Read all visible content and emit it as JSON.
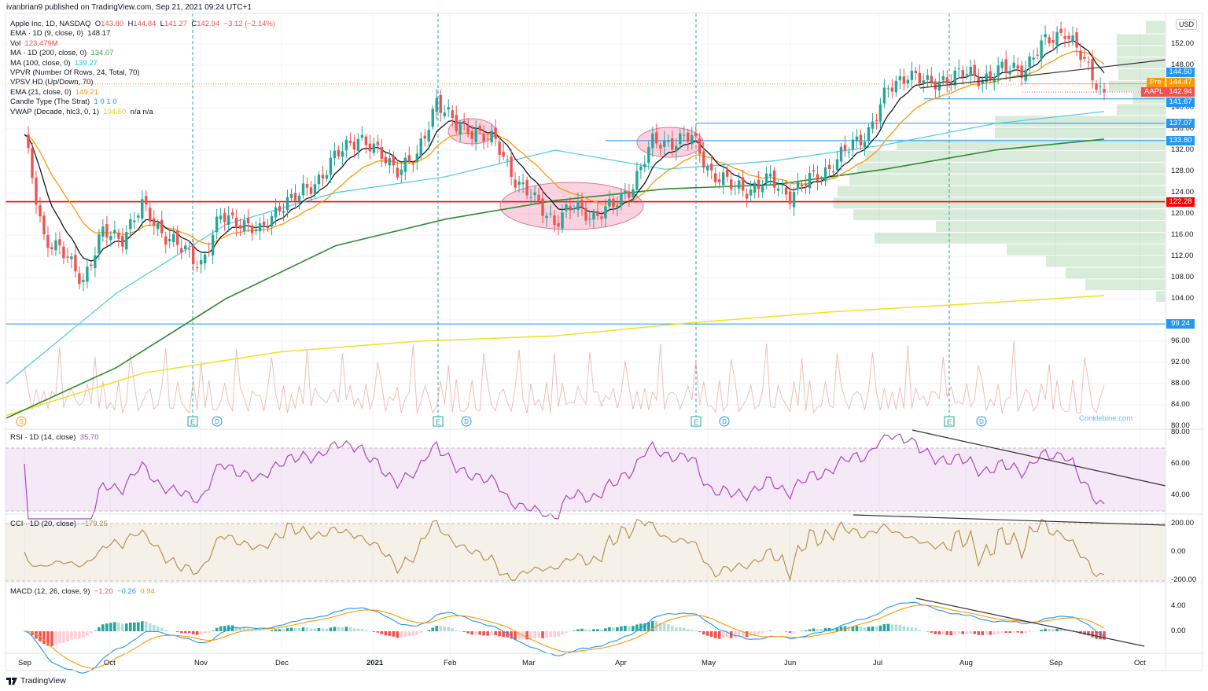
{
  "header": {
    "publisher": "ivanbrian9 published on TradingView.com, Sep 21, 2021 09:24 UTC+1"
  },
  "legend": {
    "symbol": "Apple Inc, 1D, NASDAQ",
    "o_label": "O",
    "o": "143.80",
    "h_label": "H",
    "h": "144.84",
    "l_label": "L",
    "l": "141.27",
    "c_label": "C",
    "c": "142.94",
    "change": "−3.12 (−2.14%)",
    "ema9": "EMA · 1D (9, close, 0)",
    "ema9_val": "148.17",
    "vol": "Vol",
    "vol_val": "123.479M",
    "ma200": "MA · 1D (200, close, 0)",
    "ma200_val": "134.07",
    "ma100": "MA (100, close, 0)",
    "ma100_val": "139.27",
    "vpvr": "VPVR (Number Of Rows, 24, Total, 70)",
    "vpsv": "VPSV HD (Up/Down, 70)",
    "ema21": "EMA (21, close, 0)",
    "ema21_val": "149.21",
    "candle": "Candle Type (The Strat)",
    "candle_val": "1 0 1 0",
    "vwap": "VWAP (Decade, hlc3, 0, 1)",
    "vwap_val": "104.60",
    "vwap_na": "n/a  n/a"
  },
  "rsi": {
    "label": "RSI · 1D (14, close)",
    "value": "35.70"
  },
  "cci": {
    "label": "CCI · 1D (20, close)",
    "value": "−179.25"
  },
  "macd": {
    "label": "MACD (12, 26, close, 9)",
    "v1": "−1.20",
    "v2": "−0.26",
    "v3": "0.94"
  },
  "badges": {
    "usd": "USD",
    "b1": "144.50",
    "pre_tag": "Pre",
    "pre": "144.47",
    "sym_tag": "AAPL",
    "last": "142.94",
    "b2": "141.67",
    "b3": "137.07",
    "b4": "133.80",
    "b5": "122.28",
    "b6": "99.24"
  },
  "events": {
    "earnings": "E",
    "dividend": "D",
    "split": "S"
  },
  "watermark": "Crinklebine.com",
  "footer": {
    "brand": "TradingView"
  },
  "colors": {
    "up": "#26a69a",
    "down": "#ef5350",
    "ema9": "#131722",
    "ema21": "#ff9800",
    "ma100": "#4dc9e6",
    "ma200": "#2e8b2e",
    "vwap": "#f2e024",
    "rsi": "#ab47bc",
    "cci": "#b08a4a",
    "macd": "#2196f3",
    "signal": "#ff9800"
  },
  "chart_data": {
    "type": "candlestick",
    "title": "Apple Inc, 1D, NASDAQ",
    "x_tick_labels": [
      "Sep",
      "Oct",
      "Nov",
      "Dec",
      "2021",
      "Feb",
      "Mar",
      "Apr",
      "May",
      "Jun",
      "Jul",
      "Aug",
      "Sep",
      "Oct"
    ],
    "y_ticks": [
      152,
      148,
      140,
      136,
      132,
      128,
      124,
      120,
      116,
      112,
      108,
      104,
      96,
      92,
      88,
      84,
      80
    ],
    "ylim": [
      80,
      158
    ],
    "weekly_closes": [
      134,
      116,
      112,
      108,
      116,
      116,
      121,
      117,
      113,
      111,
      119,
      119,
      116,
      122,
      123,
      127,
      131,
      135,
      131,
      129,
      130,
      142,
      136,
      136,
      133,
      127,
      122,
      119,
      121,
      120,
      121,
      126,
      133,
      134,
      134,
      128,
      125,
      125,
      126,
      124,
      126,
      129,
      132,
      136,
      143,
      147,
      144,
      146,
      146,
      146,
      147,
      148,
      152,
      155,
      148,
      143
    ],
    "ma200_anchors": [
      81.5,
      91,
      104,
      114,
      119,
      122.5,
      124.7,
      125.5,
      128.4,
      132,
      134.07
    ],
    "ma100_anchors": [
      88,
      105,
      118,
      124,
      127,
      132,
      128.4,
      130,
      133,
      137,
      139.27
    ],
    "vwap_anchors": [
      82,
      90,
      94,
      96,
      97,
      99.5,
      101.5,
      103,
      104.6
    ],
    "horizontal_levels": [
      122.28,
      99.24,
      137.07,
      133.8,
      141.67,
      144.5
    ],
    "vpvr_rows": [
      {
        "low": 154,
        "high": 156.5,
        "vol": 25
      },
      {
        "low": 151.8,
        "high": 154,
        "vol": 62
      },
      {
        "low": 149.6,
        "high": 151.8,
        "vol": 62
      },
      {
        "low": 147.4,
        "high": 149.6,
        "vol": 62
      },
      {
        "low": 145.2,
        "high": 147.4,
        "vol": 60
      },
      {
        "low": 143,
        "high": 145.2,
        "vol": 72
      },
      {
        "low": 140.8,
        "high": 143,
        "vol": 42
      },
      {
        "low": 138.6,
        "high": 140.8,
        "vol": 62
      },
      {
        "low": 136.4,
        "high": 138.6,
        "vol": 217
      },
      {
        "low": 134.2,
        "high": 136.4,
        "vol": 217
      },
      {
        "low": 132,
        "high": 134.2,
        "vol": 342
      },
      {
        "low": 129.8,
        "high": 132,
        "vol": 382
      },
      {
        "low": 127.6,
        "high": 129.8,
        "vol": 392
      },
      {
        "low": 125.4,
        "high": 127.6,
        "vol": 402
      },
      {
        "low": 123.2,
        "high": 125.4,
        "vol": 417
      },
      {
        "low": 121,
        "high": 123.2,
        "vol": 422
      },
      {
        "low": 118.8,
        "high": 121,
        "vol": 397
      },
      {
        "low": 116.6,
        "high": 118.8,
        "vol": 292
      },
      {
        "low": 114.4,
        "high": 116.6,
        "vol": 370
      },
      {
        "low": 112.2,
        "high": 114.4,
        "vol": 202
      },
      {
        "low": 110,
        "high": 112.2,
        "vol": 152
      },
      {
        "low": 107.8,
        "high": 110,
        "vol": 127
      },
      {
        "low": 105.6,
        "high": 107.8,
        "vol": 102
      },
      {
        "low": 103.4,
        "high": 105.6,
        "vol": 12
      }
    ],
    "rsi_ticks": [
      80,
      60,
      40
    ],
    "cci_ticks": [
      200,
      0,
      -200
    ],
    "macd_ticks": [
      4,
      0
    ]
  }
}
